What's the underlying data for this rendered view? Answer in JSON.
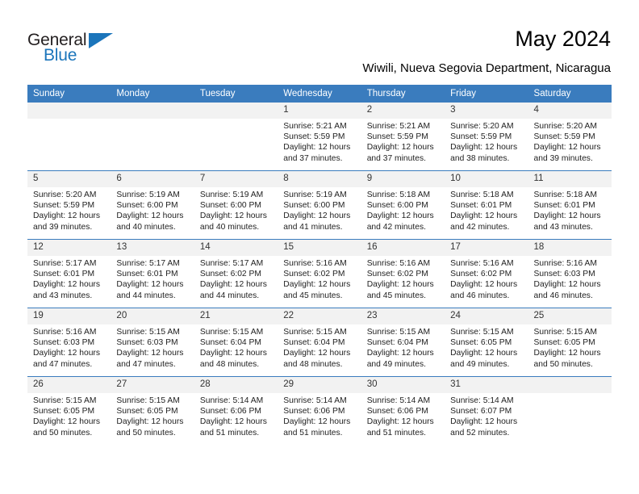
{
  "brand": {
    "name_part1": "General",
    "name_part2": "Blue",
    "accent_color": "#1b75bb"
  },
  "header": {
    "title": "May 2024",
    "subtitle": "Wiwili, Nueva Segovia Department, Nicaragua"
  },
  "calendar": {
    "header_color": "#3a7cbe",
    "daynum_band_color": "#f2f2f2",
    "weekday_headers": [
      "Sunday",
      "Monday",
      "Tuesday",
      "Wednesday",
      "Thursday",
      "Friday",
      "Saturday"
    ],
    "weeks": [
      [
        {
          "day": "",
          "empty": true
        },
        {
          "day": "",
          "empty": true
        },
        {
          "day": "",
          "empty": true
        },
        {
          "day": "1",
          "sunrise": "Sunrise: 5:21 AM",
          "sunset": "Sunset: 5:59 PM",
          "daylight": "Daylight: 12 hours and 37 minutes."
        },
        {
          "day": "2",
          "sunrise": "Sunrise: 5:21 AM",
          "sunset": "Sunset: 5:59 PM",
          "daylight": "Daylight: 12 hours and 37 minutes."
        },
        {
          "day": "3",
          "sunrise": "Sunrise: 5:20 AM",
          "sunset": "Sunset: 5:59 PM",
          "daylight": "Daylight: 12 hours and 38 minutes."
        },
        {
          "day": "4",
          "sunrise": "Sunrise: 5:20 AM",
          "sunset": "Sunset: 5:59 PM",
          "daylight": "Daylight: 12 hours and 39 minutes."
        }
      ],
      [
        {
          "day": "5",
          "sunrise": "Sunrise: 5:20 AM",
          "sunset": "Sunset: 5:59 PM",
          "daylight": "Daylight: 12 hours and 39 minutes."
        },
        {
          "day": "6",
          "sunrise": "Sunrise: 5:19 AM",
          "sunset": "Sunset: 6:00 PM",
          "daylight": "Daylight: 12 hours and 40 minutes."
        },
        {
          "day": "7",
          "sunrise": "Sunrise: 5:19 AM",
          "sunset": "Sunset: 6:00 PM",
          "daylight": "Daylight: 12 hours and 40 minutes."
        },
        {
          "day": "8",
          "sunrise": "Sunrise: 5:19 AM",
          "sunset": "Sunset: 6:00 PM",
          "daylight": "Daylight: 12 hours and 41 minutes."
        },
        {
          "day": "9",
          "sunrise": "Sunrise: 5:18 AM",
          "sunset": "Sunset: 6:00 PM",
          "daylight": "Daylight: 12 hours and 42 minutes."
        },
        {
          "day": "10",
          "sunrise": "Sunrise: 5:18 AM",
          "sunset": "Sunset: 6:01 PM",
          "daylight": "Daylight: 12 hours and 42 minutes."
        },
        {
          "day": "11",
          "sunrise": "Sunrise: 5:18 AM",
          "sunset": "Sunset: 6:01 PM",
          "daylight": "Daylight: 12 hours and 43 minutes."
        }
      ],
      [
        {
          "day": "12",
          "sunrise": "Sunrise: 5:17 AM",
          "sunset": "Sunset: 6:01 PM",
          "daylight": "Daylight: 12 hours and 43 minutes."
        },
        {
          "day": "13",
          "sunrise": "Sunrise: 5:17 AM",
          "sunset": "Sunset: 6:01 PM",
          "daylight": "Daylight: 12 hours and 44 minutes."
        },
        {
          "day": "14",
          "sunrise": "Sunrise: 5:17 AM",
          "sunset": "Sunset: 6:02 PM",
          "daylight": "Daylight: 12 hours and 44 minutes."
        },
        {
          "day": "15",
          "sunrise": "Sunrise: 5:16 AM",
          "sunset": "Sunset: 6:02 PM",
          "daylight": "Daylight: 12 hours and 45 minutes."
        },
        {
          "day": "16",
          "sunrise": "Sunrise: 5:16 AM",
          "sunset": "Sunset: 6:02 PM",
          "daylight": "Daylight: 12 hours and 45 minutes."
        },
        {
          "day": "17",
          "sunrise": "Sunrise: 5:16 AM",
          "sunset": "Sunset: 6:02 PM",
          "daylight": "Daylight: 12 hours and 46 minutes."
        },
        {
          "day": "18",
          "sunrise": "Sunrise: 5:16 AM",
          "sunset": "Sunset: 6:03 PM",
          "daylight": "Daylight: 12 hours and 46 minutes."
        }
      ],
      [
        {
          "day": "19",
          "sunrise": "Sunrise: 5:16 AM",
          "sunset": "Sunset: 6:03 PM",
          "daylight": "Daylight: 12 hours and 47 minutes."
        },
        {
          "day": "20",
          "sunrise": "Sunrise: 5:15 AM",
          "sunset": "Sunset: 6:03 PM",
          "daylight": "Daylight: 12 hours and 47 minutes."
        },
        {
          "day": "21",
          "sunrise": "Sunrise: 5:15 AM",
          "sunset": "Sunset: 6:04 PM",
          "daylight": "Daylight: 12 hours and 48 minutes."
        },
        {
          "day": "22",
          "sunrise": "Sunrise: 5:15 AM",
          "sunset": "Sunset: 6:04 PM",
          "daylight": "Daylight: 12 hours and 48 minutes."
        },
        {
          "day": "23",
          "sunrise": "Sunrise: 5:15 AM",
          "sunset": "Sunset: 6:04 PM",
          "daylight": "Daylight: 12 hours and 49 minutes."
        },
        {
          "day": "24",
          "sunrise": "Sunrise: 5:15 AM",
          "sunset": "Sunset: 6:05 PM",
          "daylight": "Daylight: 12 hours and 49 minutes."
        },
        {
          "day": "25",
          "sunrise": "Sunrise: 5:15 AM",
          "sunset": "Sunset: 6:05 PM",
          "daylight": "Daylight: 12 hours and 50 minutes."
        }
      ],
      [
        {
          "day": "26",
          "sunrise": "Sunrise: 5:15 AM",
          "sunset": "Sunset: 6:05 PM",
          "daylight": "Daylight: 12 hours and 50 minutes."
        },
        {
          "day": "27",
          "sunrise": "Sunrise: 5:15 AM",
          "sunset": "Sunset: 6:05 PM",
          "daylight": "Daylight: 12 hours and 50 minutes."
        },
        {
          "day": "28",
          "sunrise": "Sunrise: 5:14 AM",
          "sunset": "Sunset: 6:06 PM",
          "daylight": "Daylight: 12 hours and 51 minutes."
        },
        {
          "day": "29",
          "sunrise": "Sunrise: 5:14 AM",
          "sunset": "Sunset: 6:06 PM",
          "daylight": "Daylight: 12 hours and 51 minutes."
        },
        {
          "day": "30",
          "sunrise": "Sunrise: 5:14 AM",
          "sunset": "Sunset: 6:06 PM",
          "daylight": "Daylight: 12 hours and 51 minutes."
        },
        {
          "day": "31",
          "sunrise": "Sunrise: 5:14 AM",
          "sunset": "Sunset: 6:07 PM",
          "daylight": "Daylight: 12 hours and 52 minutes."
        },
        {
          "day": "",
          "empty": true
        }
      ]
    ]
  }
}
